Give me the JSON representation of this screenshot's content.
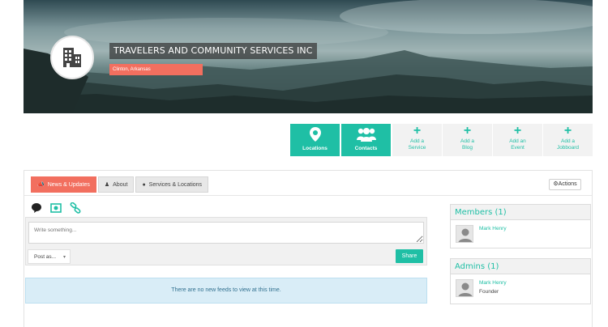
{
  "org": {
    "name": "TRAVELERS AND COMMUNITY SERVICES INC",
    "location": "Clinton, Arkansas"
  },
  "action_tiles": [
    {
      "label": "Locations",
      "icon": "map-marker-icon",
      "style": "teal"
    },
    {
      "label": "Contacts",
      "icon": "users-icon",
      "style": "teal"
    },
    {
      "label": "Add a Service",
      "icon": "plus-icon",
      "style": "grey"
    },
    {
      "label": "Add a Blog",
      "icon": "plus-icon",
      "style": "grey"
    },
    {
      "label": "Add an Event",
      "icon": "plus-icon",
      "style": "grey"
    },
    {
      "label": "Add a Jobboard",
      "icon": "plus-icon",
      "style": "grey"
    }
  ],
  "tabs": [
    {
      "label": "News & Updates",
      "icon": "bullhorn-icon",
      "active": true
    },
    {
      "label": "About",
      "icon": "user-icon",
      "active": false
    },
    {
      "label": "Services & Locations",
      "icon": "globe-icon",
      "active": false
    }
  ],
  "actions_label": "Actions",
  "composer": {
    "placeholder": "Write something...",
    "post_as": "Post as...",
    "share": "Share"
  },
  "feed": {
    "empty_message": "There are no new feeds to view at this time."
  },
  "members": {
    "title": "Members (1)",
    "items": [
      {
        "name": "Mark Henry"
      }
    ]
  },
  "admins": {
    "title": "Admins (1)",
    "items": [
      {
        "name": "Mark Henry",
        "role": "Founder"
      }
    ]
  },
  "colors": {
    "accent": "#1fbfa5",
    "coral": "#f26f5f",
    "info_bg": "#d9edf7"
  }
}
